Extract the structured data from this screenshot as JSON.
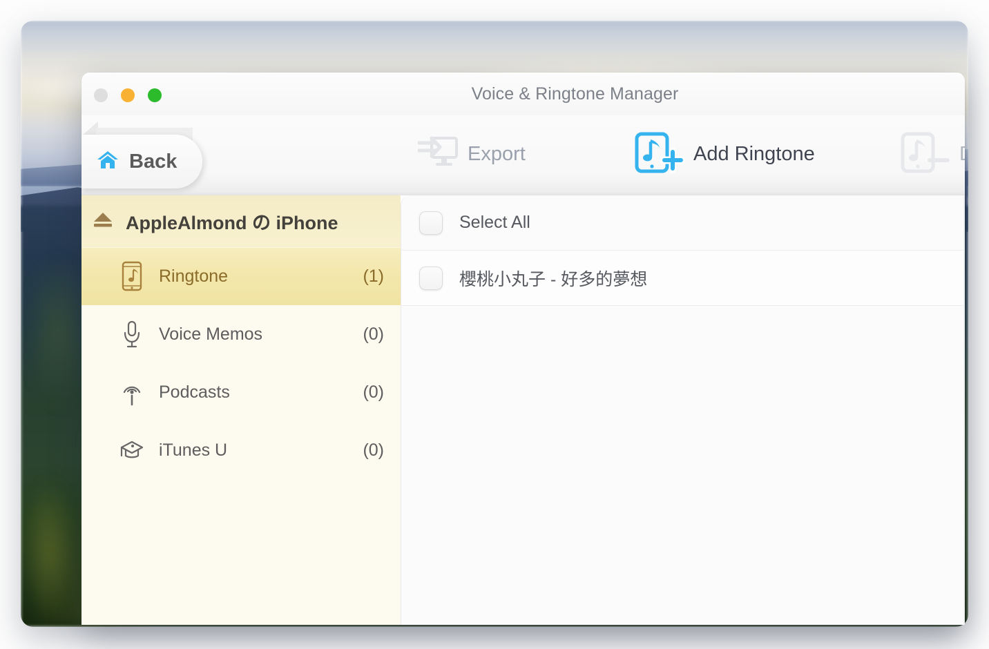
{
  "window": {
    "title": "Voice & Ringtone Manager",
    "traffic_lights": [
      "close",
      "minimize",
      "maximize"
    ]
  },
  "toolbar": {
    "back_label": "Back",
    "items": [
      {
        "label": "Export",
        "icon": "export-monitor-icon",
        "enabled": false
      },
      {
        "label": "Add Ringtone",
        "icon": "add-ringtone-icon",
        "enabled": true
      },
      {
        "label": "De",
        "icon": "delete-ringtone-icon",
        "enabled": false,
        "truncated": true
      }
    ]
  },
  "sidebar": {
    "device_name": "AppleAlmond の iPhone",
    "eject_icon": "eject-icon",
    "items": [
      {
        "label": "Ringtone",
        "count": "(1)",
        "icon": "ringtone-phone-note-icon",
        "selected": true
      },
      {
        "label": "Voice Memos",
        "count": "(0)",
        "icon": "microphone-icon",
        "selected": false
      },
      {
        "label": "Podcasts",
        "count": "(0)",
        "icon": "podcast-broadcast-icon",
        "selected": false
      },
      {
        "label": "iTunes U",
        "count": "(0)",
        "icon": "graduation-cap-icon",
        "selected": false
      }
    ]
  },
  "content": {
    "select_all_label": "Select All",
    "select_all_checked": false,
    "rows": [
      {
        "label": "櫻桃小丸子 - 好多的夢想",
        "checked": false
      }
    ]
  },
  "colors": {
    "accent_blue": "#34b3ef",
    "selected_gold": "#f3e7ab",
    "sidebar_cream": "#fdfaef",
    "gold_text": "#8a6b2a",
    "dim_text": "#9aa1ac"
  }
}
